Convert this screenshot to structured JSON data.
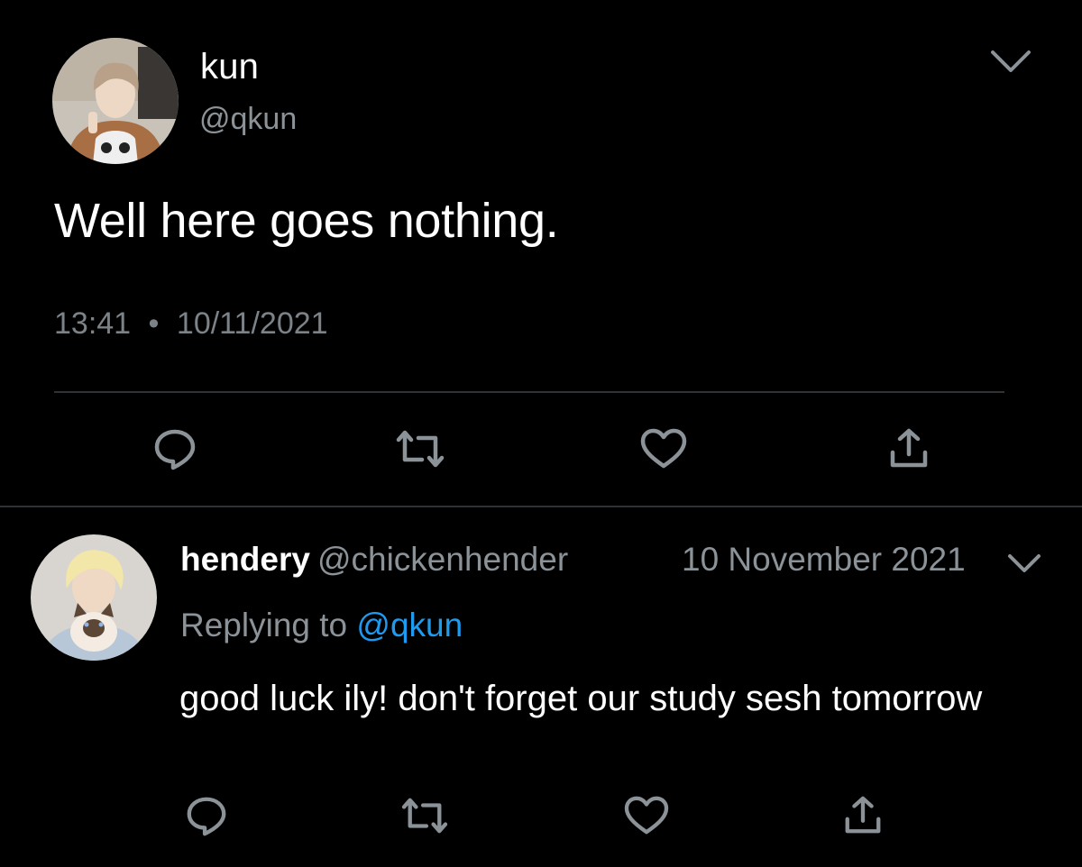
{
  "main_tweet": {
    "display_name": "kun",
    "handle": "@qkun",
    "text": "Well here goes nothing.",
    "time": "13:41",
    "separator": "•",
    "date": "10/11/2021"
  },
  "reply": {
    "display_name": "hendery",
    "handle": "@chickenhender",
    "date": "10 November 2021",
    "replying_prefix": "Replying to",
    "replying_to": "@qkun",
    "text": "good luck ily! don't forget our study sesh tomorrow"
  },
  "icons": {
    "options": "chevron-down-icon",
    "reply": "speech-bubble-icon",
    "retweet": "retweet-icon",
    "like": "heart-icon",
    "share": "share-icon"
  },
  "colors": {
    "background": "#000000",
    "primary_text": "#ffffff",
    "secondary_text": "#8b9298",
    "icon": "#8b9298",
    "mention": "#1d9bf0",
    "divider": "#2f3336"
  }
}
